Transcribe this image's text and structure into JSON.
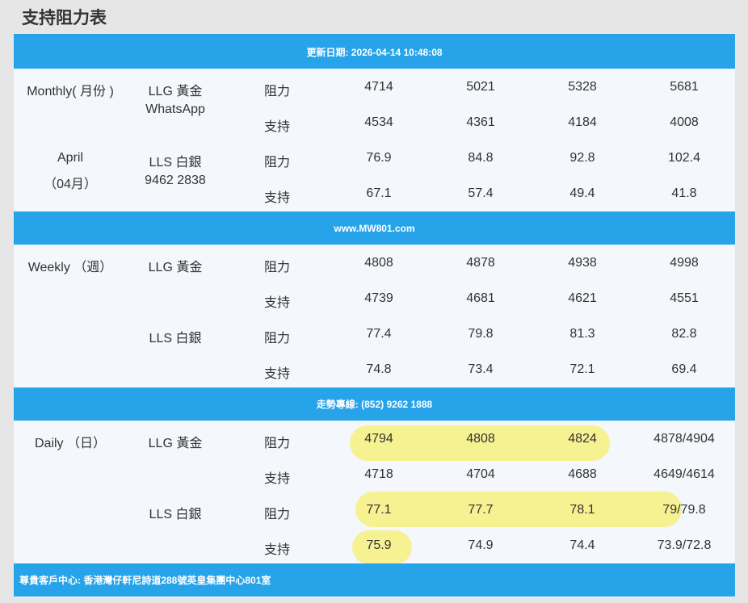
{
  "page_title": "支持阻力表",
  "bands": {
    "update": "更新日期: 2026-04-14 10:48:08",
    "website": "www.MW801.com",
    "hotline": "走勢專線: (852) 9262 1888",
    "address": "尊貴客戶中心: 香港灣仔軒尼詩道288號英皇集團中心801室"
  },
  "monthly": {
    "period": "Monthly( 月份 )",
    "month": "April",
    "month_cn": "（04月）",
    "gold": "LLG 黃金",
    "whatsapp": "WhatsApp",
    "silver": "LLS 白銀",
    "phone": "9462 2838",
    "rows": [
      {
        "label": "阻力",
        "values": [
          "4714",
          "5021",
          "5328",
          "5681"
        ]
      },
      {
        "label": "支持",
        "values": [
          "4534",
          "4361",
          "4184",
          "4008"
        ]
      },
      {
        "label": "阻力",
        "values": [
          "76.9",
          "84.8",
          "92.8",
          "102.4"
        ]
      },
      {
        "label": "支持",
        "values": [
          "67.1",
          "57.4",
          "49.4",
          "41.8"
        ]
      }
    ]
  },
  "weekly": {
    "period": "Weekly （週）",
    "gold": "LLG 黃金",
    "silver": "LLS 白銀",
    "rows": [
      {
        "label": "阻力",
        "values": [
          "4808",
          "4878",
          "4938",
          "4998"
        ]
      },
      {
        "label": "支持",
        "values": [
          "4739",
          "4681",
          "4621",
          "4551"
        ]
      },
      {
        "label": "阻力",
        "values": [
          "77.4",
          "79.8",
          "81.3",
          "82.8"
        ]
      },
      {
        "label": "支持",
        "values": [
          "74.8",
          "73.4",
          "72.1",
          "69.4"
        ]
      }
    ]
  },
  "daily": {
    "period": "Daily （日）",
    "gold": "LLG 黃金",
    "silver": "LLS 白銀",
    "rows": [
      {
        "label": "阻力",
        "values": [
          "4794",
          "4808",
          "4824",
          "4878/4904"
        ]
      },
      {
        "label": "支持",
        "values": [
          "4718",
          "4704",
          "4688",
          "4649/4614"
        ]
      },
      {
        "label": "阻力",
        "values": [
          "77.1",
          "77.7",
          "78.1",
          "79/79.8"
        ]
      },
      {
        "label": "支持",
        "values": [
          "75.9",
          "74.9",
          "74.4",
          "73.9/72.8"
        ]
      }
    ]
  },
  "colors": {
    "band": "#27a3e9",
    "highlight": "#f6f07e",
    "text": "#333333"
  }
}
